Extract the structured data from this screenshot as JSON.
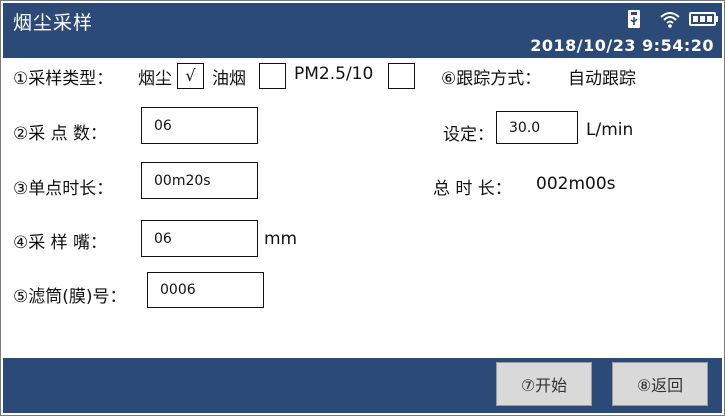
{
  "header": {
    "title": "烟尘采样",
    "datetime": "2018/10/23 9:54:20",
    "icons": [
      "usb-icon",
      "wifi-icon",
      "battery-icon"
    ]
  },
  "form": {
    "sample_type": {
      "label": "①采样类型：",
      "options": [
        {
          "label": "烟尘",
          "mark": "√"
        },
        {
          "label": "油烟",
          "mark": ""
        },
        {
          "label": "PM2.5/10",
          "mark": ""
        }
      ]
    },
    "tracking": {
      "label": "⑥跟踪方式：",
      "value": "自动跟踪"
    },
    "points": {
      "label": "②采  点  数：",
      "value": "06"
    },
    "setting": {
      "label": "设定：",
      "value": "30.0",
      "unit": "L/min"
    },
    "duration": {
      "label": "③单点时长：",
      "value": "00m20s"
    },
    "total": {
      "label": "总  时  长：",
      "value": "002m00s"
    },
    "nozzle": {
      "label": "④采  样  嘴：",
      "value": "06",
      "unit": "mm"
    },
    "filter": {
      "label": "⑤滤筒(膜)号：",
      "value": "0006"
    }
  },
  "footer": {
    "start_label": "⑦开始",
    "back_label": "⑧返回"
  },
  "colors": {
    "bar": "#2c4a78",
    "button": "#d9d9d9"
  }
}
